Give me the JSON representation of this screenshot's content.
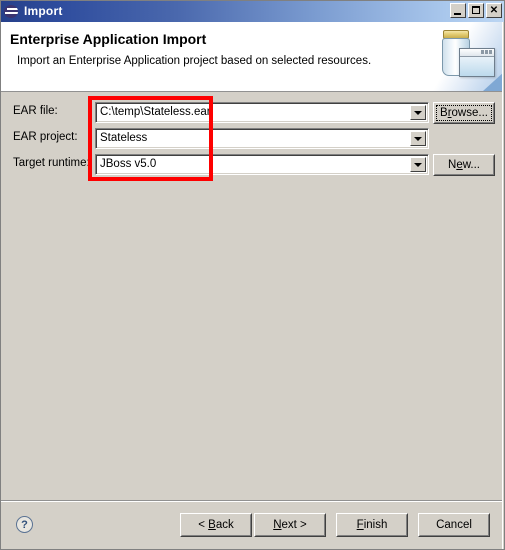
{
  "window": {
    "title": "Import",
    "icon": "eclipse-icon",
    "controls": {
      "minimize": "_",
      "maximize": "□",
      "close": "✕"
    }
  },
  "header": {
    "title": "Enterprise Application Import",
    "description": "Import an Enterprise Application project based on selected resources.",
    "banner_icon": "ear-jar-icon"
  },
  "form": {
    "fields": [
      {
        "label": "EAR file:",
        "value": "C:\\temp\\Stateless.ear",
        "name": "ear-file",
        "button": {
          "pre": "B",
          "mnemonic": "r",
          "post": "owse...",
          "name": "browse-button"
        }
      },
      {
        "label": "EAR project:",
        "value": "Stateless",
        "name": "ear-project",
        "button": null
      },
      {
        "label": "Target runtime:",
        "value": "JBoss v5.0",
        "name": "target-runtime",
        "button": {
          "pre": "N",
          "mnemonic": "e",
          "post": "w...",
          "name": "new-button"
        }
      }
    ],
    "highlight_color": "#fe0000"
  },
  "footer": {
    "help": "?",
    "buttons": [
      {
        "pre": "< ",
        "mnemonic": "B",
        "post": "ack",
        "name": "back-button"
      },
      {
        "pre": "",
        "mnemonic": "N",
        "post": "ext >",
        "name": "next-button"
      },
      {
        "pre": "",
        "mnemonic": "F",
        "post": "inish",
        "name": "finish-button"
      },
      {
        "pre": "Cancel",
        "mnemonic": "",
        "post": "",
        "name": "cancel-button"
      }
    ]
  },
  "colors": {
    "dialog_bg": "#d4d0c8",
    "title_start": "#26408a",
    "title_end": "#bcd6f3",
    "annotation": "#fe0000"
  }
}
